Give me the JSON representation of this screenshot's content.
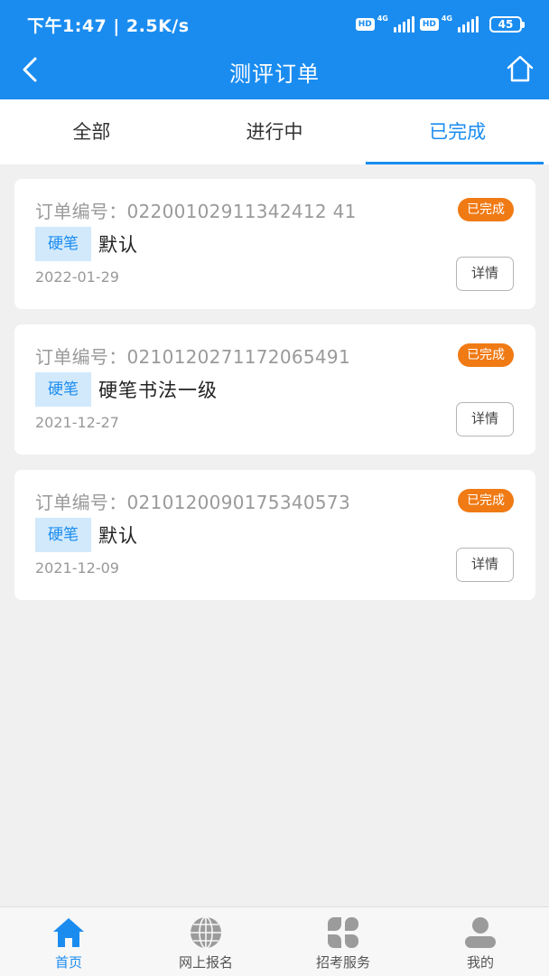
{
  "status_bar": {
    "time": "下午1:47 | 2.5K/s",
    "hd1": "HD",
    "net1": "4G",
    "hd2": "HD",
    "net2": "4G",
    "battery": "45"
  },
  "header": {
    "title": "测评订单",
    "back_icon": "chevron-left-icon",
    "home_icon": "home-icon"
  },
  "tabs": [
    {
      "label": "全部",
      "active": false
    },
    {
      "label": "进行中",
      "active": false
    },
    {
      "label": "已完成",
      "active": true
    }
  ],
  "orders": [
    {
      "order_no": "订单编号：02200102911342412 41",
      "status": "已完成",
      "tag": "硬笔",
      "name": "默认",
      "date": "2022-01-29",
      "detail_label": "详情"
    },
    {
      "order_no": "订单编号：0210120271172065491",
      "status": "已完成",
      "tag": "硬笔",
      "name": "硬笔书法一级",
      "date": "2021-12-27",
      "detail_label": "详情"
    },
    {
      "order_no": "订单编号：0210120090175340573",
      "status": "已完成",
      "tag": "硬笔",
      "name": "默认",
      "date": "2021-12-09",
      "detail_label": "详情"
    }
  ],
  "bottom_nav": [
    {
      "label": "首页",
      "icon": "home-icon",
      "active": true
    },
    {
      "label": "网上报名",
      "icon": "globe-icon",
      "active": false
    },
    {
      "label": "招考服务",
      "icon": "clover-icon",
      "active": false
    },
    {
      "label": "我的",
      "icon": "user-icon",
      "active": false
    }
  ],
  "colors": {
    "primary": "#1a8cf0",
    "status_done": "#f07a14",
    "tag_bg": "#d2e9fb",
    "background": "#f0f0f0"
  }
}
